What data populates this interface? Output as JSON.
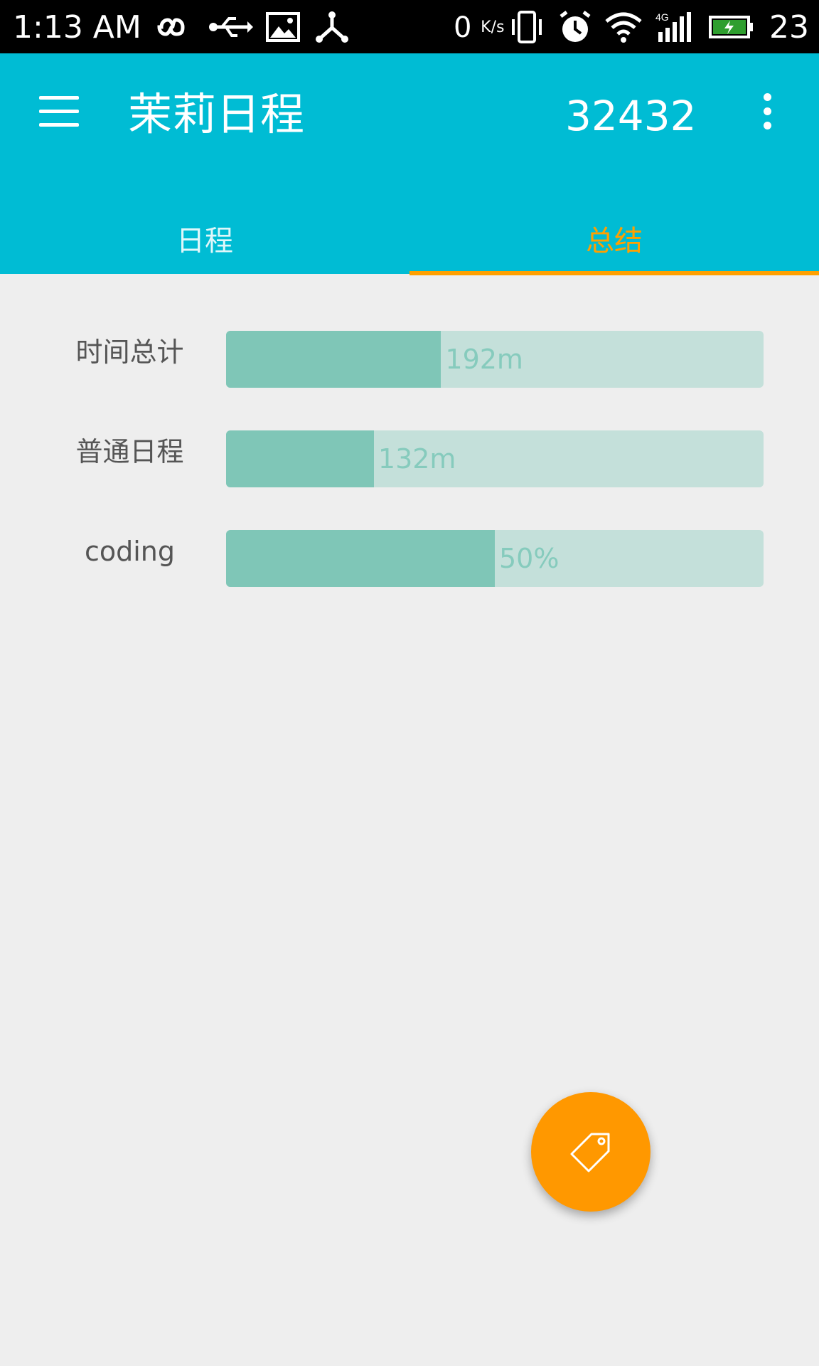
{
  "status_bar": {
    "time": "1:13 AM",
    "net_speed_value": "0",
    "net_speed_unit": "K/s",
    "battery_level": "23",
    "icons": [
      "infinity-icon",
      "usb-icon",
      "image-icon",
      "share-icon",
      "vibrate-icon",
      "alarm-icon",
      "wifi-icon",
      "signal-4g-icon",
      "battery-charging-icon"
    ]
  },
  "app_bar": {
    "title": "茉莉日程",
    "count": "32432",
    "menu_icon": "menu-icon",
    "more_icon": "more-vert-icon",
    "background": "#00bcd4"
  },
  "tabs": [
    {
      "label": "日程",
      "active": false
    },
    {
      "label": "总结",
      "active": true
    }
  ],
  "summary": [
    {
      "label": "时间总计",
      "value_text": "192m",
      "fill_fraction": 0.4
    },
    {
      "label": "普通日程",
      "value_text": "132m",
      "fill_fraction": 0.275
    },
    {
      "label": "coding",
      "value_text": "50%",
      "fill_fraction": 0.5
    }
  ],
  "fab": {
    "icon": "tag-icon",
    "color": "#ff9800"
  },
  "colors": {
    "accent": "#ffa000",
    "bar_track": "#c4e0da",
    "bar_fill": "#7fc6b7"
  }
}
